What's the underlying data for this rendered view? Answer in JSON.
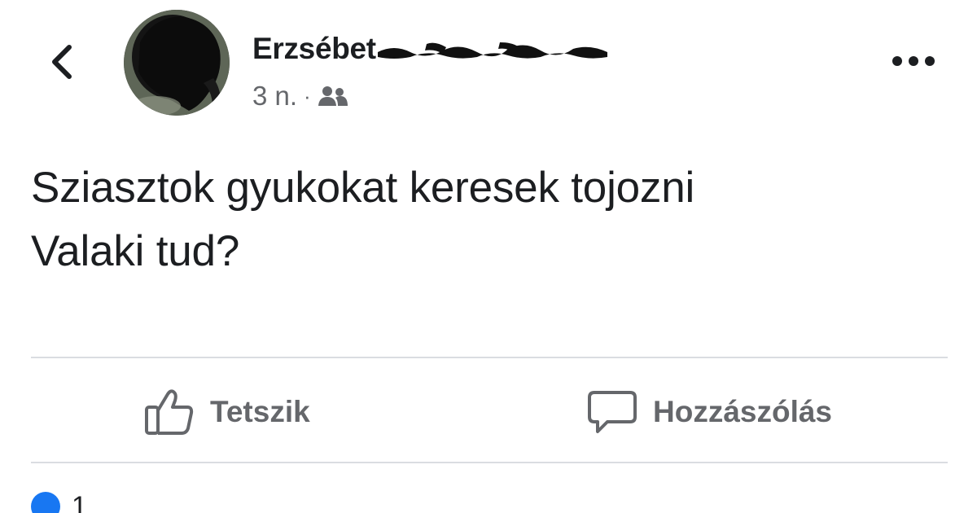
{
  "header": {
    "author_name": "Erzsébet",
    "post_time": "3 n.",
    "separator": "·",
    "audience_icon": "group-audience-icon",
    "back_icon": "chevron-left-icon",
    "more_icon": "more-horizontal-icon"
  },
  "post": {
    "lines": [
      "Sziasztok gyukokat keresek tojozni",
      "Valaki tud?"
    ]
  },
  "actions": {
    "like_label": "Tetszik",
    "like_icon": "thumbs-up-icon",
    "comment_label": "Hozzászólás",
    "comment_icon": "speech-bubble-icon"
  },
  "reactions": {
    "count": "1",
    "icon": "like-reaction-icon"
  },
  "colors": {
    "text": "#1c1e21",
    "secondary_text": "#65676b",
    "divider": "#dadde1",
    "like_blue": "#1877f2",
    "background": "#ffffff"
  }
}
